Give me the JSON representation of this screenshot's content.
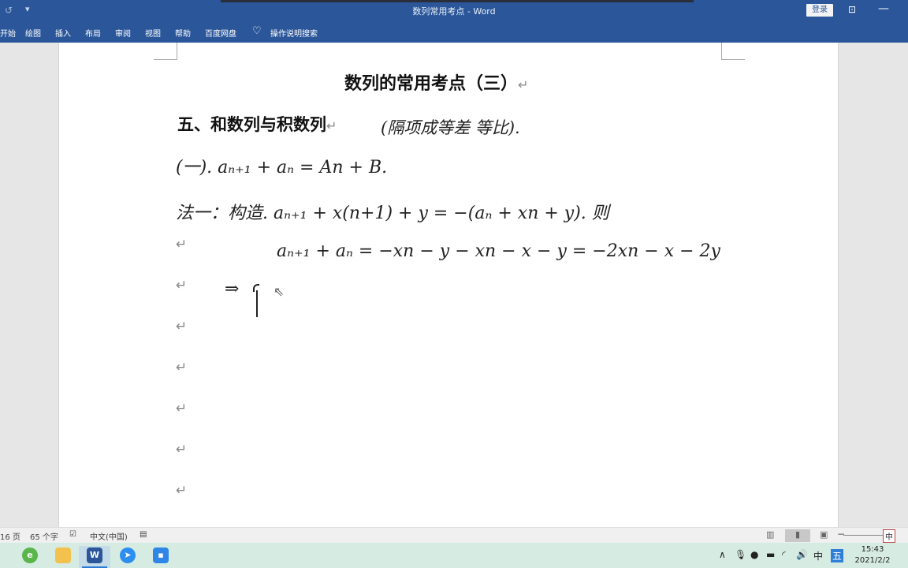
{
  "window": {
    "title": "数列常用考点 - Word",
    "login_label": "登录",
    "quick_access": [
      "undo-icon",
      "customize-icon"
    ]
  },
  "ribbon": {
    "tabs": [
      "开始",
      "绘图",
      "插入",
      "布局",
      "审阅",
      "视图",
      "帮助",
      "百度网盘"
    ],
    "search_label": "操作说明搜索"
  },
  "document": {
    "title": "数列的常用考点（三）",
    "heading": "五、和数列与积数列",
    "handwriting": {
      "note": "(隔项成等差 等比).",
      "line1": "(一). aₙ₊₁ + aₙ = An + B.",
      "line2": "法一：构造. aₙ₊₁ + x(n+1) + y = −(aₙ + xn + y). 则",
      "line3": "aₙ₊₁ + aₙ = −xn − y − xn − x − y = −2xn − x − 2y",
      "line4": "⇒"
    },
    "paragraph_mark": "↵",
    "empty_paragraph_count": 6
  },
  "statusbar": {
    "page": "16 页",
    "word_count": "65 个字",
    "language": "中文(中国)",
    "ime": "中"
  },
  "taskbar": {
    "apps": [
      "ie-browser",
      "file-explorer",
      "word",
      "feishu",
      "calendar-app"
    ],
    "tray_ime": "中",
    "tray_wubi": "五",
    "time": "15:43",
    "date": "2021/2/2"
  }
}
